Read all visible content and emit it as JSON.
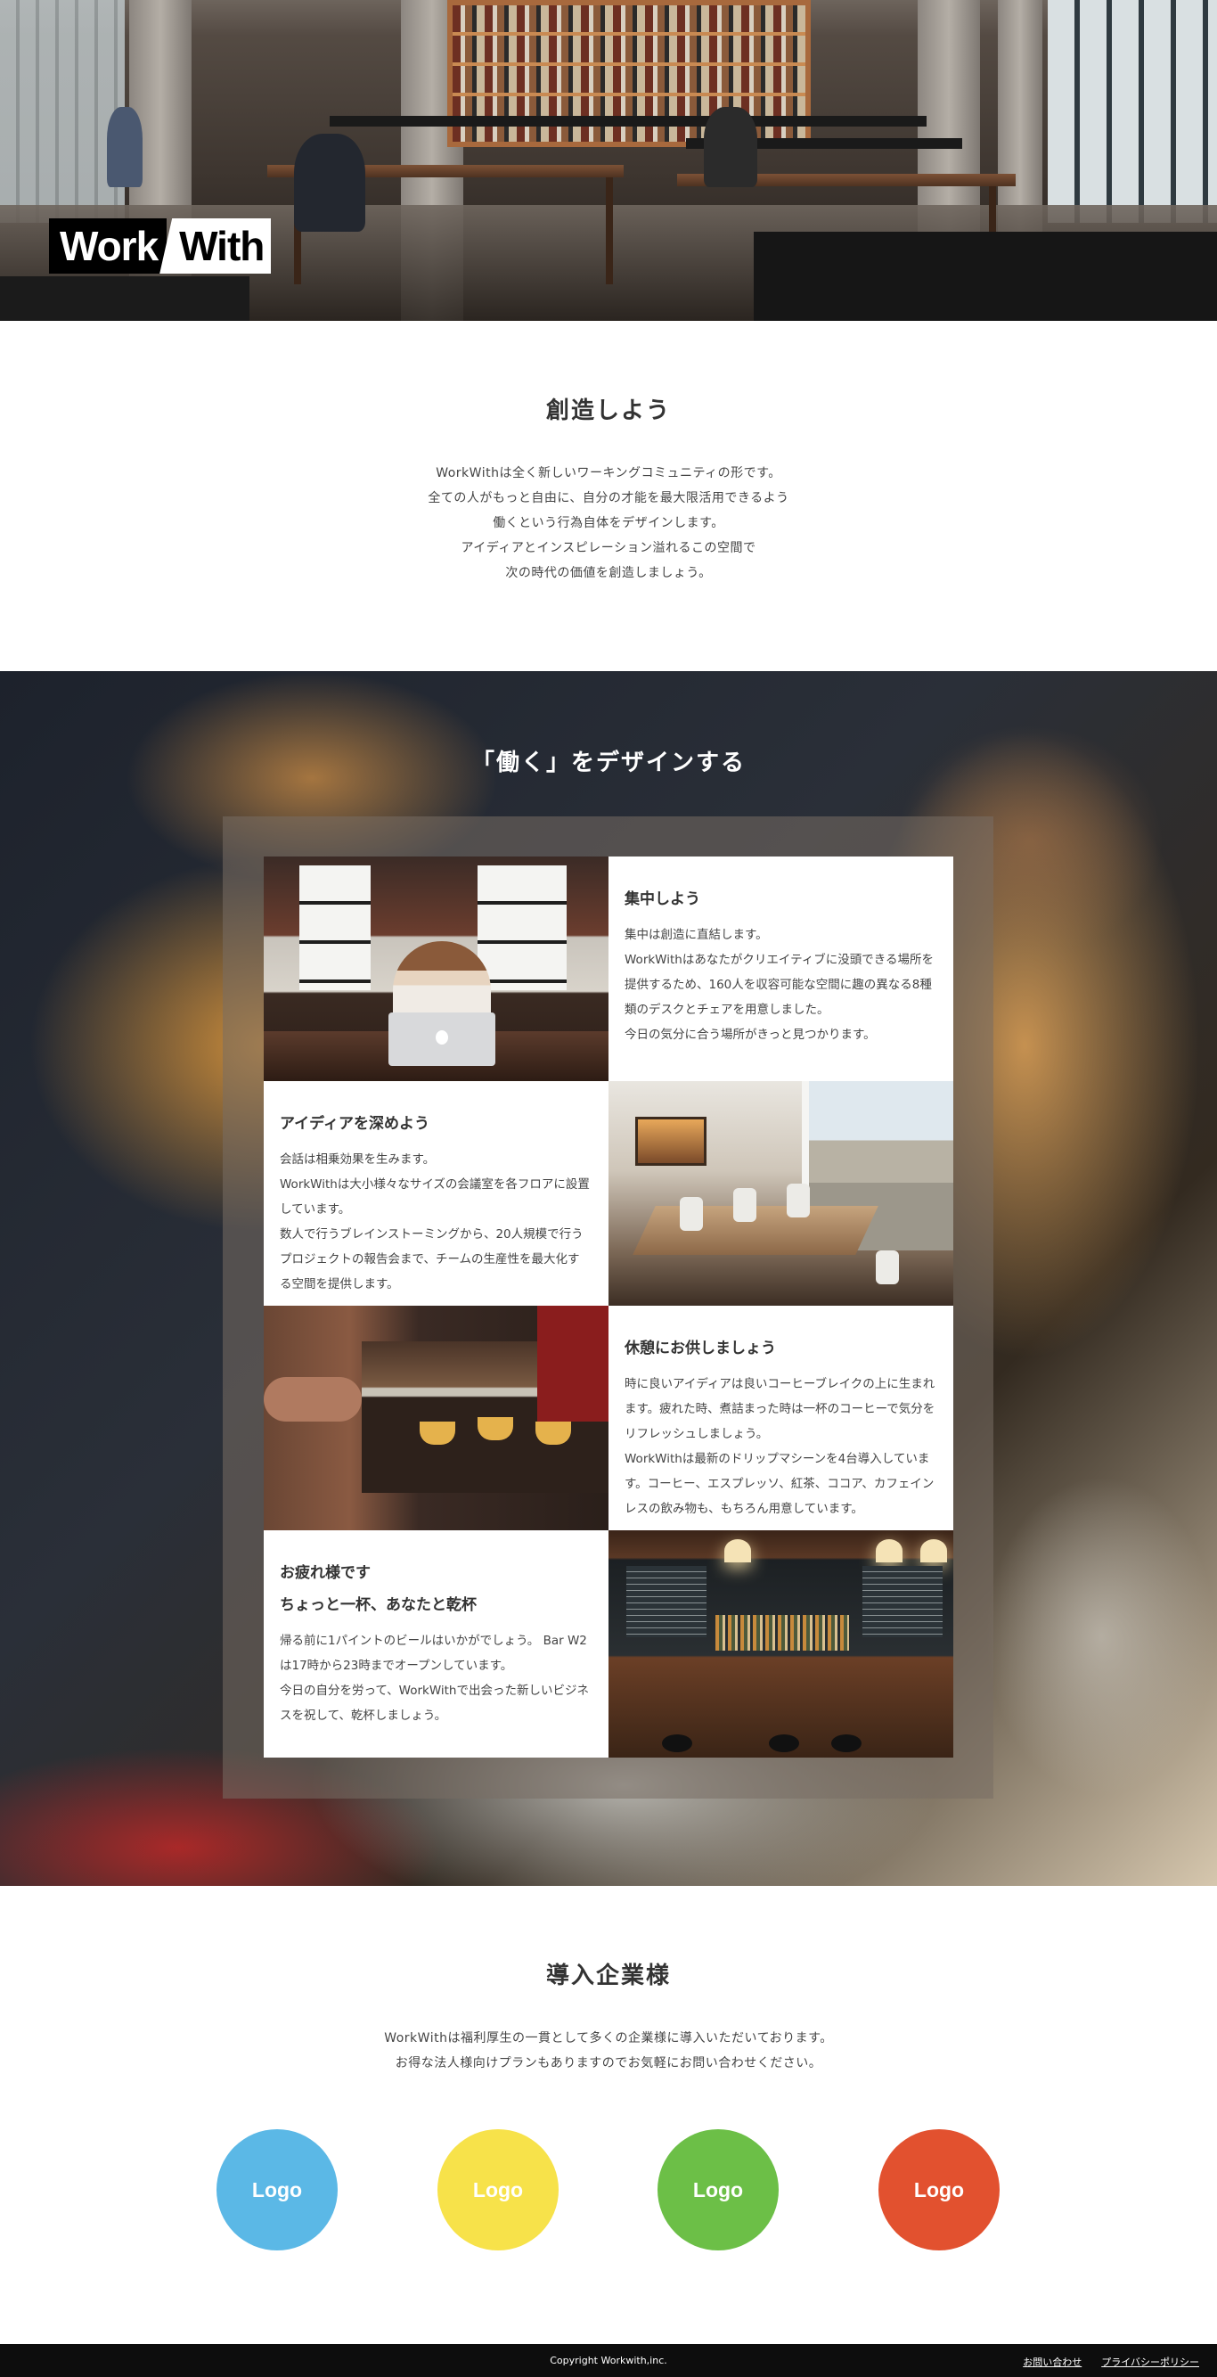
{
  "hero": {
    "logo_part1": "Work",
    "logo_part2": "With"
  },
  "intro": {
    "title": "創造しよう",
    "lines": [
      "WorkWithは全く新しいワーキングコミュニティの形です。",
      "全ての人がもっと自由に、自分の才能を最大限活用できるよう",
      "働くという行為自体をデザインします。",
      "アイディアとインスピレーション溢れるこの空間で",
      "次の時代の価値を創造しましょう。"
    ]
  },
  "design": {
    "title": "「働く」をデザインする",
    "features": [
      {
        "title_lines": [
          "集中しよう"
        ],
        "body": [
          "集中は創造に直結します。",
          "WorkWithはあなたがクリエイティブに没頭できる場所を提供するため、160人を収容可能な空間に趣の異なる8種類のデスクとチェアを用意しました。",
          "今日の気分に合う場所がきっと見つかります。"
        ]
      },
      {
        "title_lines": [
          "アイディアを深めよう"
        ],
        "body": [
          "会話は相乗効果を生みます。",
          "WorkWithは大小様々なサイズの会議室を各フロアに設置しています。",
          "数人で行うブレインストーミングから、20人規模で行うプロジェクトの報告会まで、チームの生産性を最大化する空間を提供します。"
        ]
      },
      {
        "title_lines": [
          "休憩にお供しましょう"
        ],
        "body": [
          "時に良いアイディアは良いコーヒーブレイクの上に生まれます。疲れた時、煮詰まった時は一杯のコーヒーで気分をリフレッシュしましょう。",
          "WorkWithは最新のドリップマシーンを4台導入しています。コーヒー、エスプレッソ、紅茶、ココア、カフェインレスの飲み物も、もちろん用意しています。"
        ]
      },
      {
        "title_lines": [
          "お疲れ様です",
          "ちょっと一杯、あなたと乾杯"
        ],
        "body": [
          "帰る前に1パイントのビールはいかがでしょう。 Bar W2は17時から23時までオープンしています。",
          "今日の自分を労って、WorkWithで出会った新しいビジネスを祝して、乾杯しましょう。"
        ]
      }
    ]
  },
  "partners": {
    "title": "導入企業様",
    "lines": [
      "WorkWithは福利厚生の一貫として多くの企業様に導入いただいております。",
      "お得な法人様向けプランもありますのでお気軽にお問い合わせください。"
    ],
    "logos": [
      {
        "label": "Logo",
        "color": "#5bb8e6"
      },
      {
        "label": "Logo",
        "color": "#f7e24a"
      },
      {
        "label": "Logo",
        "color": "#6cbf47"
      },
      {
        "label": "Logo",
        "color": "#e2512f"
      }
    ]
  },
  "footer": {
    "copyright": "Copyright Workwith,inc.",
    "contact_link": "お問い合わせ",
    "privacy_link": "プライバシーポリシー"
  }
}
